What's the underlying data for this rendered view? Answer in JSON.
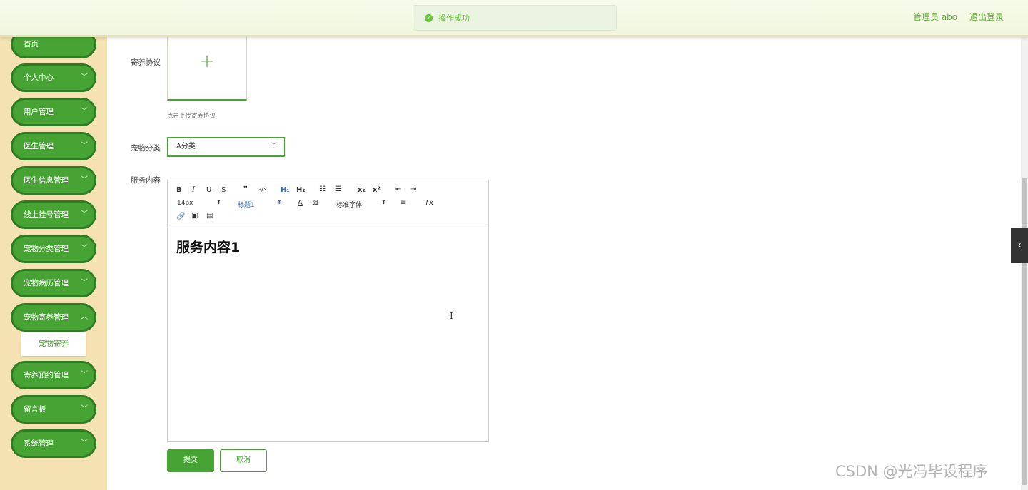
{
  "header": {
    "user_label": "管理员 abo",
    "logout_label": "退出登录"
  },
  "toast": {
    "message": "操作成功",
    "icon": "check-circle-icon"
  },
  "sidebar": {
    "items": [
      {
        "label": "首页"
      },
      {
        "label": "个人中心"
      },
      {
        "label": "用户管理"
      },
      {
        "label": "医生管理"
      },
      {
        "label": "医生信息管理"
      },
      {
        "label": "线上挂号管理"
      },
      {
        "label": "宠物分类管理"
      },
      {
        "label": "宠物病历管理"
      },
      {
        "label": "宠物寄养管理"
      },
      {
        "label": "寄养预约管理"
      },
      {
        "label": "留言板"
      },
      {
        "label": "系统管理"
      }
    ],
    "submenu_label": "宠物寄养"
  },
  "form": {
    "agreement_label": "寄养协议",
    "upload_hint": "点击上传寄养协议",
    "category_label": "宠物分类",
    "category_value": "A分类",
    "content_label": "服务内容",
    "content_text": "服务内容1",
    "submit_label": "提交",
    "cancel_label": "取消"
  },
  "editor": {
    "font_size": "14px",
    "heading": "标题1",
    "font_family": "标准字体"
  },
  "watermark": "CSDN @光冯毕设程序"
}
